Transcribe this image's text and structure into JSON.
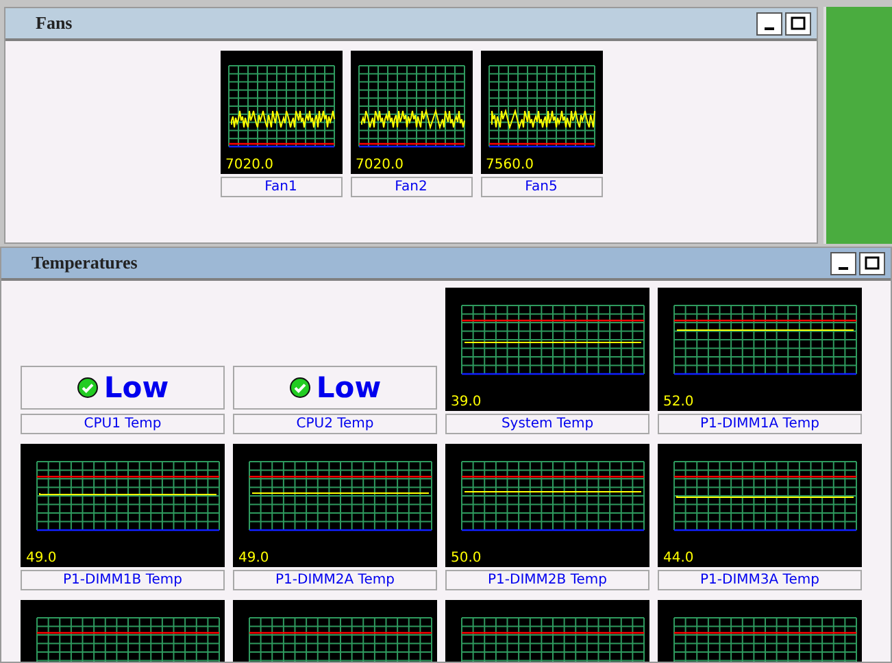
{
  "fans_panel": {
    "title": "Fans",
    "gauges": [
      {
        "reading": "7020.0",
        "label": "Fan1"
      },
      {
        "reading": "7020.0",
        "label": "Fan2"
      },
      {
        "reading": "7560.0",
        "label": "Fan5"
      }
    ]
  },
  "temperatures_panel": {
    "title": "Temperatures",
    "sensors": [
      {
        "kind": "status",
        "status": "Low",
        "ok": true,
        "label": "CPU1 Temp"
      },
      {
        "kind": "status",
        "status": "Low",
        "ok": true,
        "label": "CPU2 Temp"
      },
      {
        "kind": "graph",
        "reading": "39.0",
        "label": "System Temp"
      },
      {
        "kind": "graph",
        "reading": "52.0",
        "label": "P1-DIMM1A Temp"
      },
      {
        "kind": "graph",
        "reading": "49.0",
        "label": "P1-DIMM1B Temp"
      },
      {
        "kind": "graph",
        "reading": "49.0",
        "label": "P1-DIMM2A Temp"
      },
      {
        "kind": "graph",
        "reading": "50.0",
        "label": "P1-DIMM2B Temp"
      },
      {
        "kind": "graph",
        "reading": "44.0",
        "label": "P1-DIMM3A Temp"
      },
      {
        "kind": "graph"
      },
      {
        "kind": "graph"
      },
      {
        "kind": "graph"
      },
      {
        "kind": "graph"
      }
    ]
  }
}
